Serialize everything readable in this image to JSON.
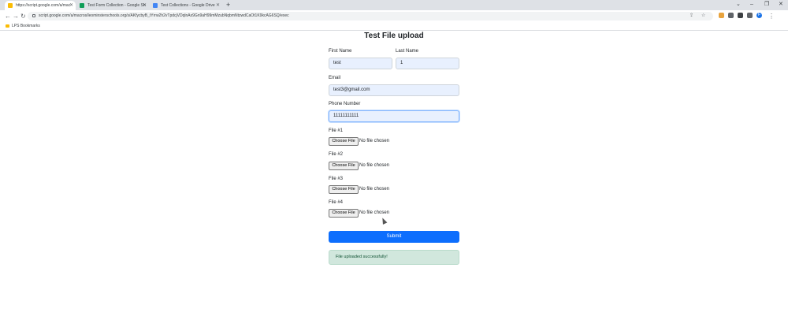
{
  "browser": {
    "tabs": [
      {
        "title": "https://script.google.com/a/mac",
        "active": true,
        "favicon_color": "#fbbc04"
      },
      {
        "title": "Test Form Collection - Google Sh",
        "active": false,
        "favicon_color": "#0f9d58"
      },
      {
        "title": "Test Collections - Google Drive",
        "active": false,
        "favicon_color": "#4285f4"
      }
    ],
    "url": "script.google.com/a/macros/leominsterschools.org/s/AKfycbyB_tYrrw2h2vTpdcjVDqlnAx9Gn9aH99mMzubNqbmNtzwdCaOt1K9kcAG6SQ/exec",
    "bookmarks_label": "LPS Bookmarks",
    "profile_letter": "F"
  },
  "form": {
    "title": "Test File upload",
    "first_name_label": "First Name",
    "first_name_value": "test",
    "last_name_label": "Last Name",
    "last_name_value": "1",
    "email_label": "Email",
    "email_value": "test3@gmail.com",
    "phone_label": "Phone Number",
    "phone_value": "11111111111",
    "files": [
      {
        "label": "File #1",
        "button": "Choose File",
        "status": "No file chosen"
      },
      {
        "label": "File #2",
        "button": "Choose File",
        "status": "No file chosen"
      },
      {
        "label": "File #3",
        "button": "Choose File",
        "status": "No file chosen"
      },
      {
        "label": "File #4",
        "button": "Choose File",
        "status": "No file chosen"
      }
    ],
    "submit_label": "Submit",
    "alert_text": "File uploaded successfully!"
  },
  "colors": {
    "primary": "#0d6efd",
    "success_bg": "#d1e7dd",
    "success_text": "#0f5132",
    "autofill_bg": "#e8f0fe"
  }
}
